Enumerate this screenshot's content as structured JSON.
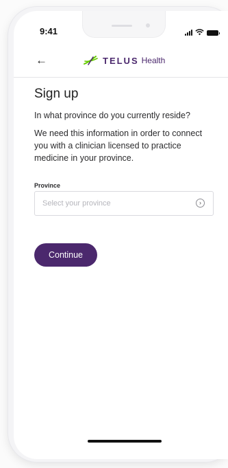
{
  "status_bar": {
    "time": "9:41",
    "icons": [
      "signal-icon",
      "wifi-icon",
      "battery-icon"
    ]
  },
  "header": {
    "back_icon": "back-arrow-icon",
    "logo_word": "TELUS",
    "logo_sub": "Health",
    "logo_icon": "telus-critter-icon"
  },
  "main": {
    "title": "Sign up",
    "question": "In what province do you currently reside?",
    "explanation": "We need this information in order to connect you with a clinician licensed to practice medicine in your province.",
    "province_label": "Province",
    "province_placeholder": "Select your province",
    "province_icon": "chevron-right-circle-icon",
    "continue_label": "Continue"
  },
  "colors": {
    "brand_purple": "#4b286d",
    "brand_green": "#66cc00",
    "text": "#2a2a2c",
    "placeholder": "#b5b5bb",
    "border": "#d9d9de"
  }
}
